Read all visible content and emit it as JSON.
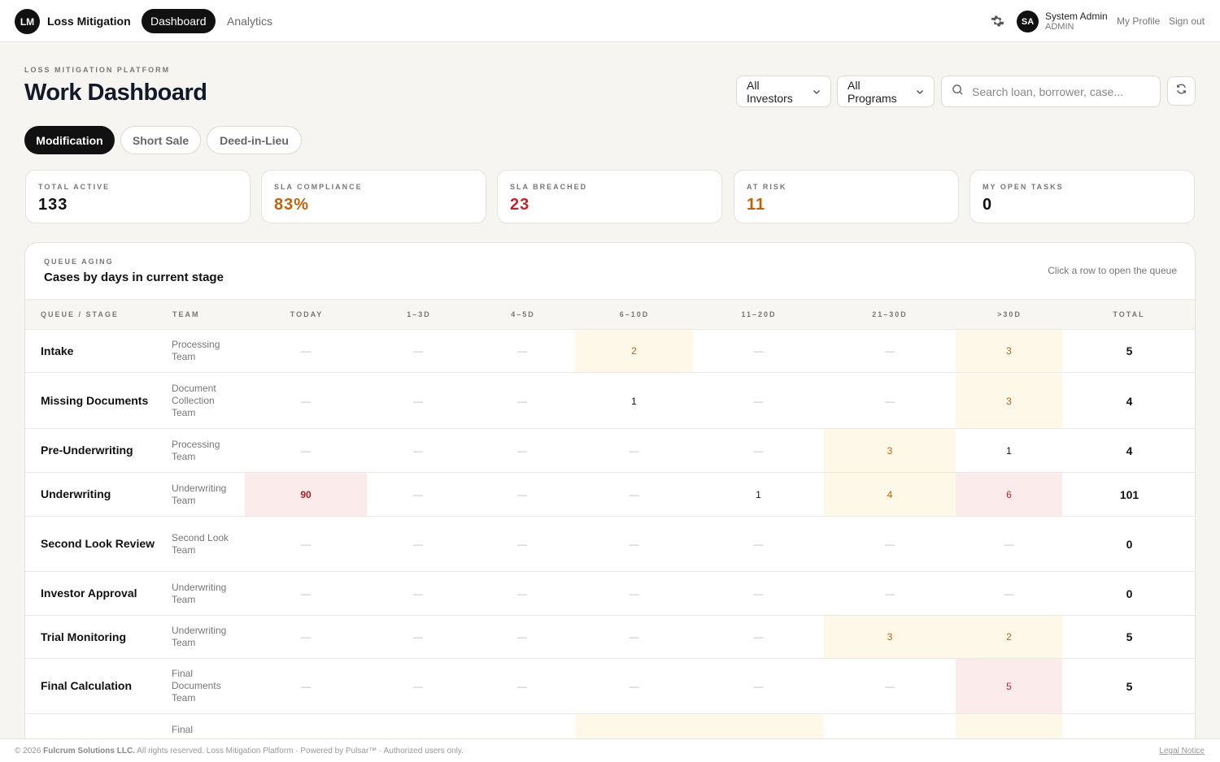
{
  "nav": {
    "logo": "LM",
    "app_name": "Loss Mitigation",
    "tabs": [
      {
        "label": "Dashboard",
        "active": true
      },
      {
        "label": "Analytics",
        "active": false
      }
    ],
    "user": {
      "initials": "SA",
      "name": "System Admin",
      "role": "ADMIN"
    },
    "my_profile": "My Profile",
    "sign_out": "Sign out"
  },
  "header": {
    "eyebrow": "LOSS MITIGATION PLATFORM",
    "title": "Work Dashboard",
    "investor_filter": "All Investors",
    "program_filter": "All Programs",
    "search_placeholder": "Search loan, borrower, case..."
  },
  "program_tabs": [
    {
      "label": "Modification",
      "active": true
    },
    {
      "label": "Short Sale",
      "active": false
    },
    {
      "label": "Deed-in-Lieu",
      "active": false
    }
  ],
  "stats": [
    {
      "label": "TOTAL ACTIVE",
      "value": "133",
      "color": "#111111"
    },
    {
      "label": "SLA COMPLIANCE",
      "value": "83%",
      "color": "#c0620b"
    },
    {
      "label": "SLA BREACHED",
      "value": "23",
      "color": "#c0262d"
    },
    {
      "label": "AT RISK",
      "value": "11",
      "color": "#c0620b"
    },
    {
      "label": "MY OPEN TASKS",
      "value": "0",
      "color": "#111111"
    }
  ],
  "aging": {
    "eyebrow": "QUEUE AGING",
    "title": "Cases by days in current stage",
    "hint": "Click a row to open the queue",
    "columns": [
      "QUEUE / STAGE",
      "TEAM",
      "TODAY",
      "1–3D",
      "4–5D",
      "6–10D",
      "11–20D",
      "21–30D",
      ">30D",
      "TOTAL"
    ],
    "rows": [
      {
        "stage": "Intake",
        "team": "Processing Team",
        "cells": [
          "—",
          "—",
          "—",
          "2",
          "—",
          "—",
          "3"
        ],
        "total": "5"
      },
      {
        "stage": "Missing Documents",
        "team": "Document Collection Team",
        "cells": [
          "—",
          "—",
          "—",
          "1",
          "—",
          "—",
          "3"
        ],
        "total": "4"
      },
      {
        "stage": "Pre-Underwriting",
        "team": "Processing Team",
        "cells": [
          "—",
          "—",
          "—",
          "—",
          "—",
          "3",
          "1"
        ],
        "total": "4"
      },
      {
        "stage": "Underwriting",
        "team": "Underwriting Team",
        "cells": [
          "90",
          "—",
          "—",
          "—",
          "1",
          "4",
          "6"
        ],
        "total": "101"
      },
      {
        "stage": "Second Look Review",
        "team": "Second Look Team",
        "cells": [
          "—",
          "—",
          "—",
          "—",
          "—",
          "—",
          "—"
        ],
        "total": "0"
      },
      {
        "stage": "Investor Approval",
        "team": "Underwriting Team",
        "cells": [
          "—",
          "—",
          "—",
          "—",
          "—",
          "—",
          "—"
        ],
        "total": "0"
      },
      {
        "stage": "Trial Monitoring",
        "team": "Underwriting Team",
        "cells": [
          "—",
          "—",
          "—",
          "—",
          "—",
          "3",
          "2"
        ],
        "total": "5"
      },
      {
        "stage": "Final Calculation",
        "team": "Final Documents Team",
        "cells": [
          "—",
          "—",
          "—",
          "—",
          "—",
          "—",
          "5"
        ],
        "total": "5"
      },
      {
        "stage": "",
        "team": "Final",
        "cells": [
          "",
          "",
          "",
          "",
          "",
          "",
          ""
        ],
        "total": ""
      }
    ]
  },
  "footer": {
    "text_pre": "© 2026 ",
    "company": "Fulcrum Solutions LLC.",
    "text_post": " All rights reserved. Loss Mitigation Platform · Powered by Pulsar™ · Authorized users only.",
    "legal": "Legal Notice"
  }
}
